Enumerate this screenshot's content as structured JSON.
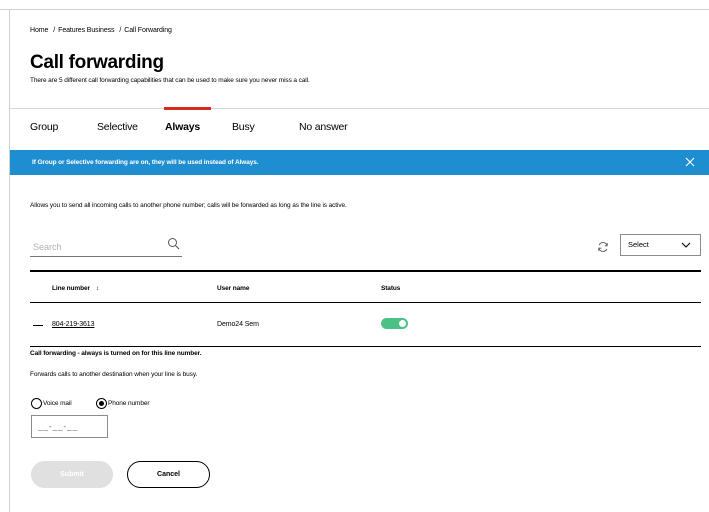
{
  "breadcrumb": {
    "items": [
      "Home",
      "Features Business",
      "Call Forwarding"
    ],
    "separator": "/"
  },
  "header": {
    "title": "Call forwarding",
    "subtitle": "There are 5 different call forwarding capabilities that can be used to make sure you never miss a call."
  },
  "tabs": [
    {
      "label": "Group",
      "active": false
    },
    {
      "label": "Selective",
      "active": false
    },
    {
      "label": "Always",
      "active": true
    },
    {
      "label": "Busy",
      "active": false
    },
    {
      "label": "No answer",
      "active": false
    }
  ],
  "banner": {
    "text": "If Group or Selective forwarding are on, they will be used instead of Always.",
    "close_icon": "close-icon",
    "color": "#1f8ed1"
  },
  "description": "Allows you to send all incoming calls to another phone number; calls will be forwarded as long as the line is active.",
  "search": {
    "placeholder": "Search",
    "icon": "search-icon"
  },
  "toolbar": {
    "refresh_icon": "refresh-icon",
    "select_value": "Select"
  },
  "table": {
    "columns": [
      "Line number",
      "User name",
      "Status"
    ],
    "sort_glyph": "↕",
    "rows": [
      {
        "line_number": "804-219-3613",
        "user_name": "Demo24 Sem",
        "status_on": true
      }
    ]
  },
  "detail": {
    "status_message": "Call forwarding - always is turned on for this line number.",
    "forward_description": "Forwards calls to another destination when your line is busy.",
    "options": [
      {
        "label": "Voice mail",
        "checked": false
      },
      {
        "label": "Phone number",
        "checked": true
      }
    ],
    "phone_placeholder": "__-__-__"
  },
  "actions": {
    "submit_label": "Submit",
    "cancel_label": "Cancel"
  },
  "colors": {
    "accent_red": "#d52b1e",
    "toggle_green": "#4bc087"
  }
}
